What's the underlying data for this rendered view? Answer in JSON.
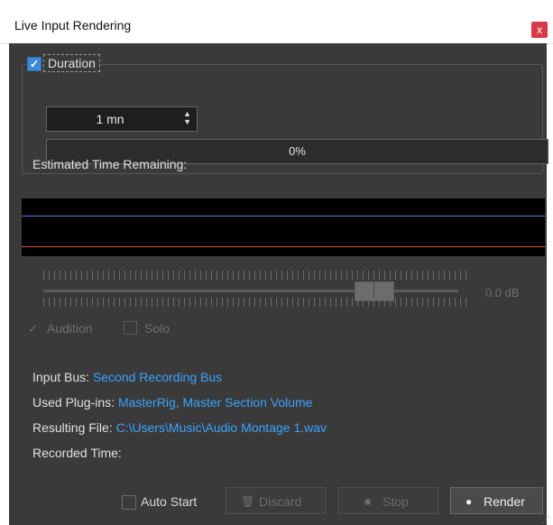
{
  "window": {
    "title": "Live Input Rendering",
    "close_glyph": "x"
  },
  "duration": {
    "checkbox_label": "Duration",
    "checked": true,
    "value": "1 mn",
    "progress_text": "0%",
    "progress_fraction": 0,
    "estimated_time_label": "Estimated Time Remaining:"
  },
  "meter": {
    "channel_colors": [
      "#5a78e0",
      "#e64a3c"
    ]
  },
  "monitor": {
    "gain_value": "0.0 dB",
    "audition_label": "Audition",
    "audition_checked": true,
    "solo_label": "Solo",
    "solo_checked": false
  },
  "info": {
    "input_bus_label": "Input Bus:",
    "input_bus_value": "Second Recording Bus",
    "plugins_label": "Used Plug-ins:",
    "plugins_value": "MasterRig, Master Section Volume",
    "file_label": "Resulting File:",
    "file_value": "C:\\Users\\Music\\Audio Montage 1.wav",
    "recorded_label": "Recorded Time:",
    "recorded_value": ""
  },
  "footer": {
    "autostart_label": "Auto Start",
    "autostart_checked": false,
    "discard_label": "Discard",
    "stop_label": "Stop",
    "render_label": "Render",
    "discard_icon": "trash-icon",
    "stop_icon": "stop-square-icon",
    "render_icon": "record-dot-icon"
  },
  "colors": {
    "accent": "#3d8bd6",
    "link": "#39a3ff",
    "close": "#d93a4a",
    "panel": "#3a3a3a"
  }
}
